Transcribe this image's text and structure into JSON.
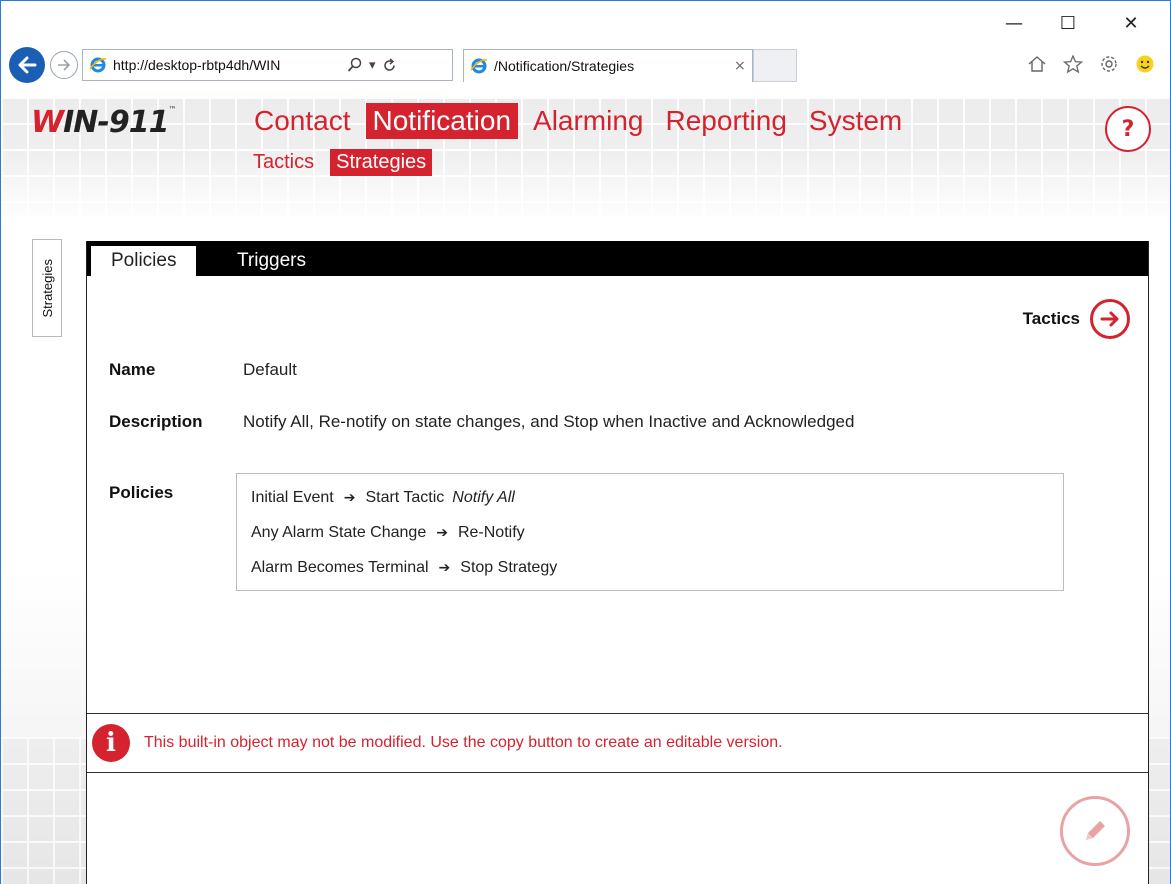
{
  "browser": {
    "window_controls": {
      "minimize": "—",
      "maximize": "☐",
      "close": "✕"
    },
    "address": "http://desktop-rbtp4dh/WIN",
    "tab_title": "/Notification/Strategies",
    "tab_close": "×",
    "back_icon": "back-arrow-icon",
    "forward_icon": "forward-arrow-icon"
  },
  "app": {
    "logo_w": "W",
    "logo_rest": "IN-911",
    "logo_tm": "™",
    "main_nav": [
      {
        "label": "Contact",
        "active": false
      },
      {
        "label": "Notification",
        "active": true
      },
      {
        "label": "Alarming",
        "active": false
      },
      {
        "label": "Reporting",
        "active": false
      },
      {
        "label": "System",
        "active": false
      }
    ],
    "sub_nav": [
      {
        "label": "Tactics",
        "active": false
      },
      {
        "label": "Strategies",
        "active": true
      }
    ],
    "help_label": "?",
    "side_tab": "Strategies"
  },
  "panel": {
    "tabs": [
      {
        "label": "Policies",
        "active": true
      },
      {
        "label": "Triggers",
        "active": false
      }
    ],
    "tactics_link": "Tactics",
    "fields": {
      "name_label": "Name",
      "name_value": "Default",
      "description_label": "Description",
      "description_value": "Notify All, Re-notify on state changes, and Stop when Inactive and Acknowledged",
      "policies_label": "Policies"
    },
    "policies": [
      {
        "event": "Initial Event",
        "arrow": "➔",
        "action": "Start Tactic",
        "detail": "Notify All"
      },
      {
        "event": "Any Alarm State Change",
        "arrow": "➔",
        "action": "Re-Notify",
        "detail": ""
      },
      {
        "event": "Alarm Becomes Terminal",
        "arrow": "➔",
        "action": "Stop Strategy",
        "detail": ""
      }
    ],
    "notice_icon": "i",
    "notice": "This built-in object may not be modified. Use the copy button to create an editable version."
  },
  "colors": {
    "accent": "#d4232f",
    "browser_blue": "#1a5fb4"
  }
}
